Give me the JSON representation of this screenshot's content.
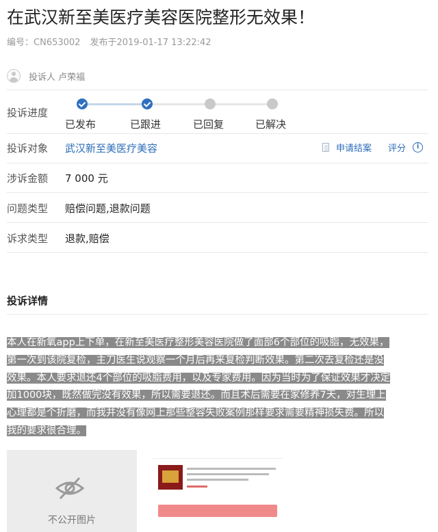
{
  "header": {
    "title": "在武汉新至美医疗美容医院整形无效果！",
    "id_label": "编号：",
    "id_value": "CN653002",
    "published_label": "发布于",
    "published_at": "2019-01-17 13:22:42"
  },
  "complainant": {
    "label": "投诉人",
    "name": "卢荣福"
  },
  "progress": {
    "label": "投诉进度",
    "steps": [
      {
        "label": "已发布",
        "done": true
      },
      {
        "label": "已跟进",
        "done": true
      },
      {
        "label": "已回复",
        "done": false
      },
      {
        "label": "已解决",
        "done": false
      }
    ]
  },
  "fields": {
    "target_label": "投诉对象",
    "target_value": "武汉新至美医疗美容",
    "apply_label": "申请结案",
    "rate_label": "评分",
    "amount_label": "涉诉金额",
    "amount_value": "7 000 元",
    "issue_type_label": "问题类型",
    "issue_type_value": "赔偿问题,退款问题",
    "appeal_type_label": "诉求类型",
    "appeal_type_value": "退款,赔偿"
  },
  "details": {
    "section_title": "投诉详情",
    "lines": [
      "本人在新氧app上下单，在新至美医疗整形美容医院做了面部6个部位的吸脂，无效果，",
      "第一次到该院复检，主刀医生说观察一个月后再来复检判断效果。第二次去复检还是没",
      "效果。本人要求退还4个部位的吸脂费用，以及专家费用。因为当时为了保证效果才决定",
      "加1000块，既然做完没有效果，所以需要退还。而且术后需要在家修养7天，对生理上",
      "心理都是个折磨，而我并没有像网上那些整容失败案例那样要求需要精神损失费。所以",
      "我的要求很合理。"
    ]
  },
  "images": {
    "private_label": "不公开图片"
  },
  "icons": {
    "avatar": "user-avatar-icon",
    "check": "check-icon",
    "document": "document-icon",
    "info": "info-icon",
    "eye_off": "eye-off-icon"
  },
  "colors": {
    "accent": "#2f6fc0",
    "link": "#2b6cb8",
    "step_done": "#2f6fc0",
    "step_todo": "#c9c9c9",
    "highlight_bg": "#8a8a8a"
  }
}
